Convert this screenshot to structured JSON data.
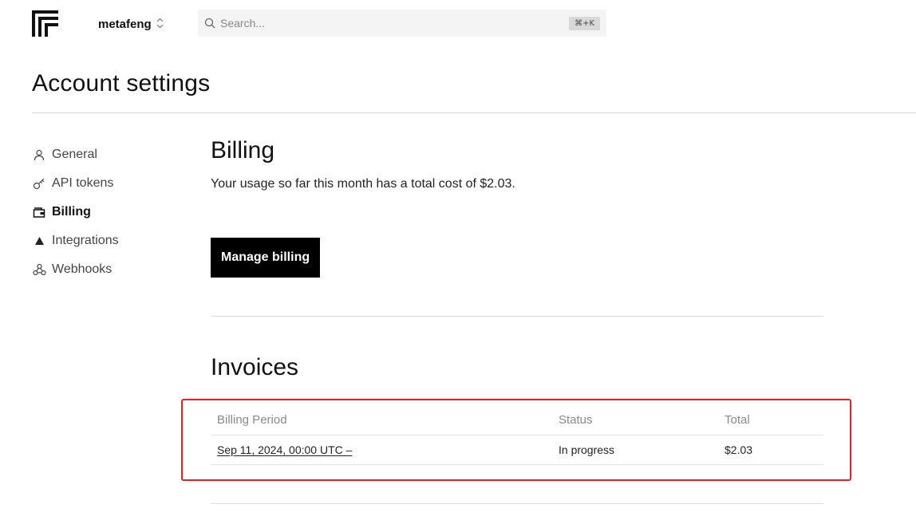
{
  "org": {
    "name": "metafeng"
  },
  "search": {
    "placeholder": "Search...",
    "shortcut": "⌘+K"
  },
  "page": {
    "title": "Account settings"
  },
  "sidebar": {
    "items": [
      {
        "label": "General",
        "icon": "user-icon",
        "active": false
      },
      {
        "label": "API tokens",
        "icon": "key-icon",
        "active": false
      },
      {
        "label": "Billing",
        "icon": "wallet-icon",
        "active": true
      },
      {
        "label": "Integrations",
        "icon": "triangle-icon",
        "active": false
      },
      {
        "label": "Webhooks",
        "icon": "webhook-icon",
        "active": false
      }
    ]
  },
  "billing": {
    "title": "Billing",
    "usage_text": "Your usage so far this month has a total cost of $2.03.",
    "manage_label": "Manage billing"
  },
  "invoices": {
    "title": "Invoices",
    "columns": [
      "Billing Period",
      "Status",
      "Total"
    ],
    "rows": [
      {
        "period": "Sep 11, 2024, 00:00 UTC –",
        "status": "In progress",
        "total": "$2.03"
      }
    ]
  },
  "colors": {
    "accent": "#000000",
    "highlight": "#e8231f"
  }
}
